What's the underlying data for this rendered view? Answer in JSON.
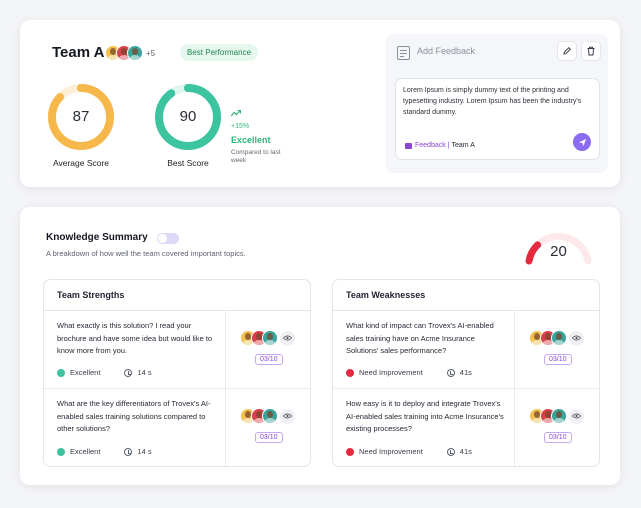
{
  "team": {
    "name": "Team A",
    "extra_members": "+5",
    "badge": "Best Performance",
    "average": {
      "value": "87",
      "label": "Average Score",
      "fill": 0.87,
      "color": "#f7b84b",
      "track": "#fdf0d9"
    },
    "best": {
      "value": "90",
      "label": "Best Score",
      "fill": 0.9,
      "color": "#3cc3a0",
      "track": "#dff5ef"
    },
    "trend": {
      "percent": "+15%",
      "status": "Excellent",
      "note": "Compared to last week",
      "color": "#2fb67c"
    }
  },
  "feedback": {
    "header": "Add Feedback",
    "text": "Lorem Ipsum is simply dummy text of the printing and typesetting industry. Lorem Ipsum has been the industry's standard dummy.",
    "tag": "Feedback | ",
    "team": "Team A"
  },
  "summary": {
    "title": "Knowledge Summary",
    "subtitle": "A breakdown of how well the team covered important topics.",
    "score": "20",
    "score_fill": 0.2,
    "score_color": "#e5293f",
    "strengths": {
      "title": "Team Strengths",
      "rows": [
        {
          "question": "What exactly is this solution? I read your brochure and have some idea but would like to know more from you.",
          "status": "Excellent",
          "time": "14 s",
          "ratio": "03/10"
        },
        {
          "question": "What are the key differentiators of Trovex's AI-enabled sales training solutions compared to other solutions?",
          "status": "Excellent",
          "time": "14 s",
          "ratio": "03/10"
        }
      ]
    },
    "weaknesses": {
      "title": "Team Weaknesses",
      "rows": [
        {
          "question": "What kind of impact can Trovex's AI-enabled sales training have on Acme Insurance Solutions' sales performance?",
          "status": "Need Improvement",
          "time": "41s",
          "ratio": "03/10"
        },
        {
          "question": "How easy is it to deploy and integrate Trovex's AI-enabled sales training into Acme Insurance's existing processes?",
          "status": "Need Improvement",
          "time": "41s",
          "ratio": "03/10"
        }
      ]
    }
  },
  "colors": {
    "excellent": "#3cc3a0",
    "need_improvement": "#e5293f",
    "accent": "#8b6cf0"
  },
  "avatar_colors": [
    "#f2c14e",
    "#d9404b",
    "#3aa39a"
  ]
}
